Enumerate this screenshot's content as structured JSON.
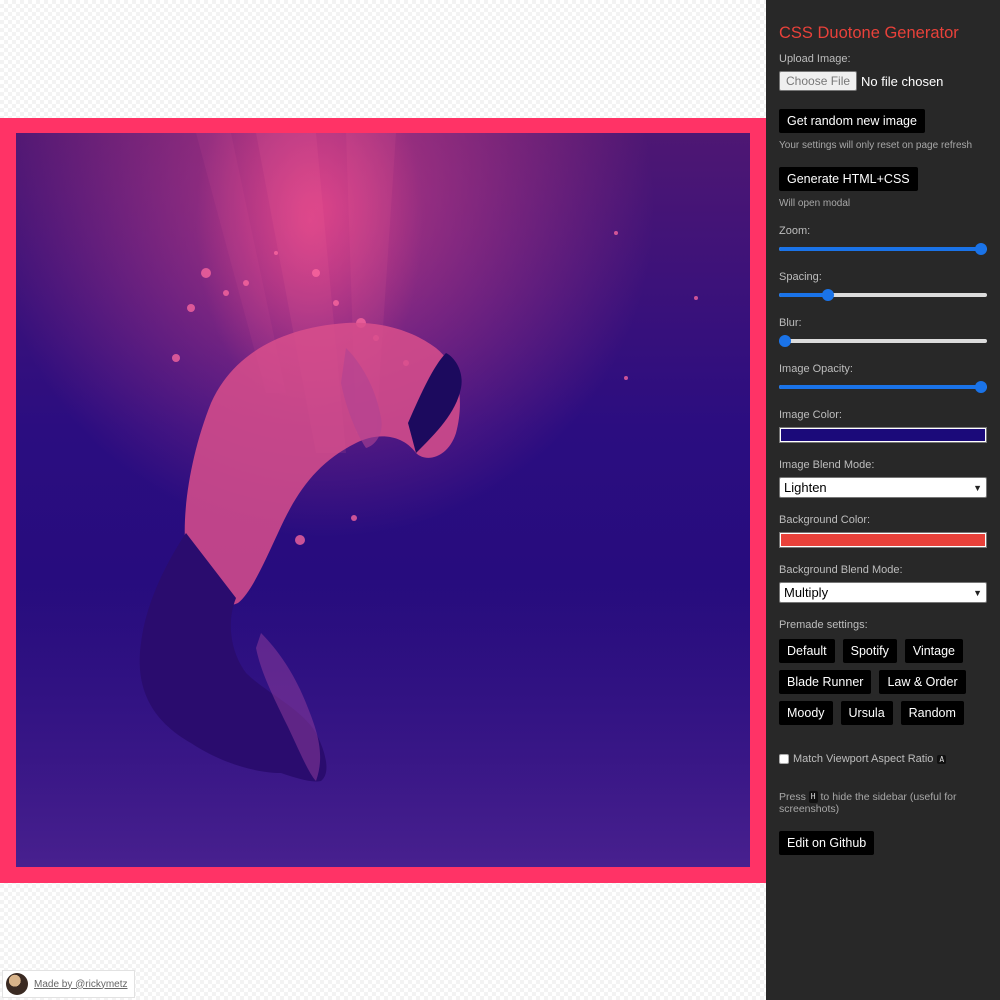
{
  "sidebar": {
    "title": "CSS Duotone Generator",
    "upload_label": "Upload Image:",
    "file_button": "Choose File",
    "file_status": "No file chosen",
    "random_button": "Get random new image",
    "random_hint": "Your settings will only reset on page refresh",
    "generate_button": "Generate HTML+CSS",
    "generate_hint": "Will open modal",
    "zoom": {
      "label": "Zoom:",
      "value": 1.0
    },
    "spacing": {
      "label": "Spacing:",
      "value": 0.22
    },
    "blur": {
      "label": "Blur:",
      "value": 0.0
    },
    "opacity": {
      "label": "Image Opacity:",
      "value": 1.0
    },
    "image_color": {
      "label": "Image Color:",
      "color": "#1b0a7a"
    },
    "image_blend": {
      "label": "Image Blend Mode:",
      "selected": "Lighten"
    },
    "background_color": {
      "label": "Background Color:",
      "color": "#e8413a"
    },
    "background_blend": {
      "label": "Background Blend Mode:",
      "selected": "Multiply"
    },
    "premade_label": "Premade settings:",
    "presets": [
      "Default",
      "Spotify",
      "Vintage",
      "Blade Runner",
      "Law & Order",
      "Moody",
      "Ursula",
      "Random"
    ],
    "aspect_label": "Match Viewport Aspect Ratio",
    "aspect_key": "A",
    "press_before": "Press",
    "press_key": "H",
    "press_after": "to hide the sidebar (useful for screenshots)",
    "github_button": "Edit on Github"
  },
  "stage": {
    "frame_color": "#ff3366"
  },
  "credit": {
    "text": "Made by @rickymetz"
  },
  "colors": {
    "sidebar_bg": "#282828",
    "accent": "#e8413a",
    "slider": "#1a73e8"
  }
}
